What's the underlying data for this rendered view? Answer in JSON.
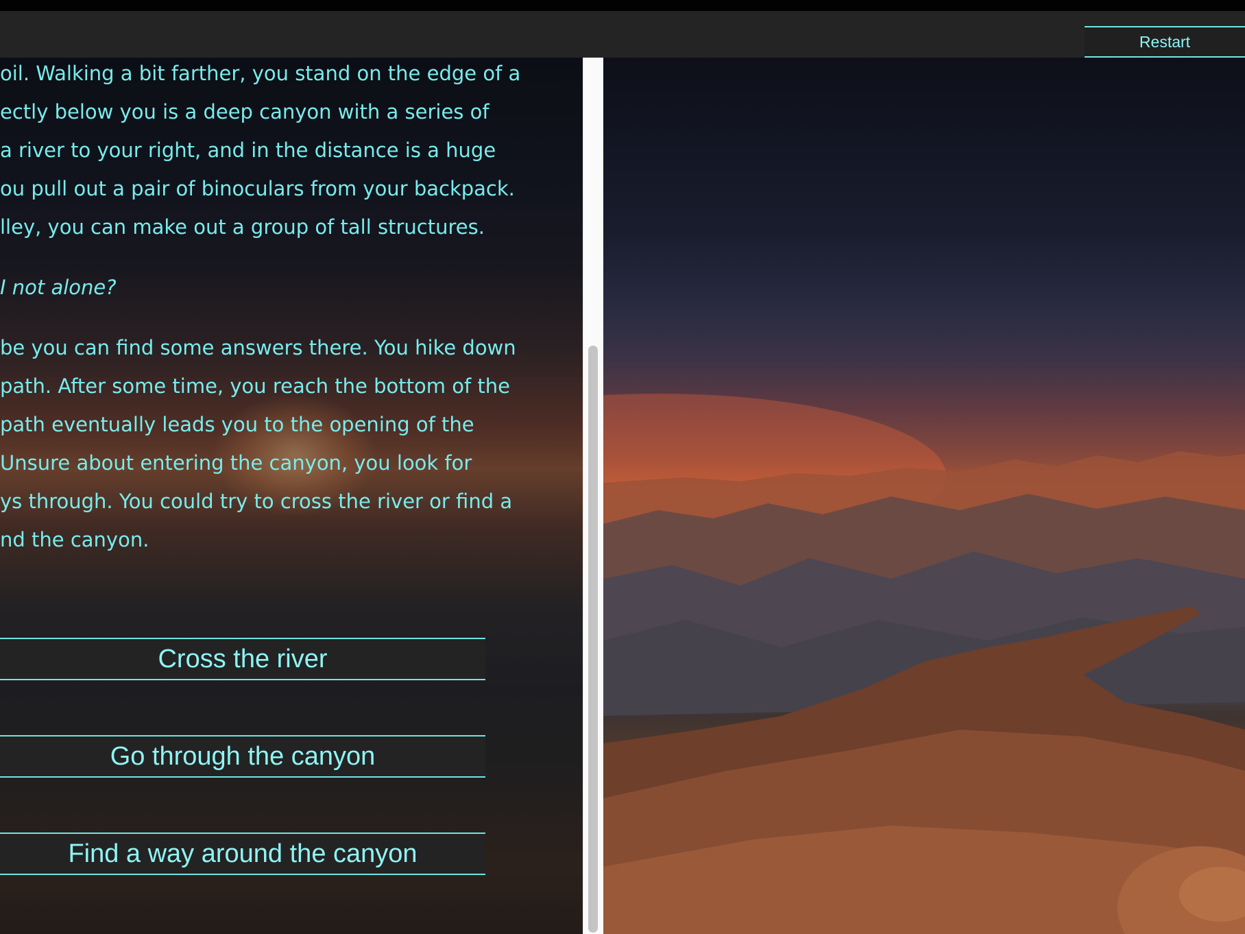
{
  "header": {
    "restart_label": "Restart"
  },
  "story": {
    "lines": [
      "oil. Walking a bit farther, you stand on the edge of a",
      "ectly below you is a deep canyon with a series of",
      " a river to your right, and in the distance is a huge",
      "ou pull out a pair of binoculars from your backpack.",
      "lley, you can make out a group of tall structures."
    ],
    "thought": "I not alone?",
    "lines2": [
      "be you can find some answers there. You hike down",
      "path. After some time, you reach the bottom of the",
      " path eventually leads you to the opening of the",
      "Unsure about entering the canyon, you look for",
      "ys through. You could try to cross the river or find a",
      "nd the canyon."
    ]
  },
  "choices": [
    {
      "label": "Cross the river"
    },
    {
      "label": "Go through the canyon"
    },
    {
      "label": "Find a way around the canyon"
    }
  ],
  "colors": {
    "accent": "#6fe6e6",
    "text": "#78ecec",
    "bar": "#242424"
  }
}
